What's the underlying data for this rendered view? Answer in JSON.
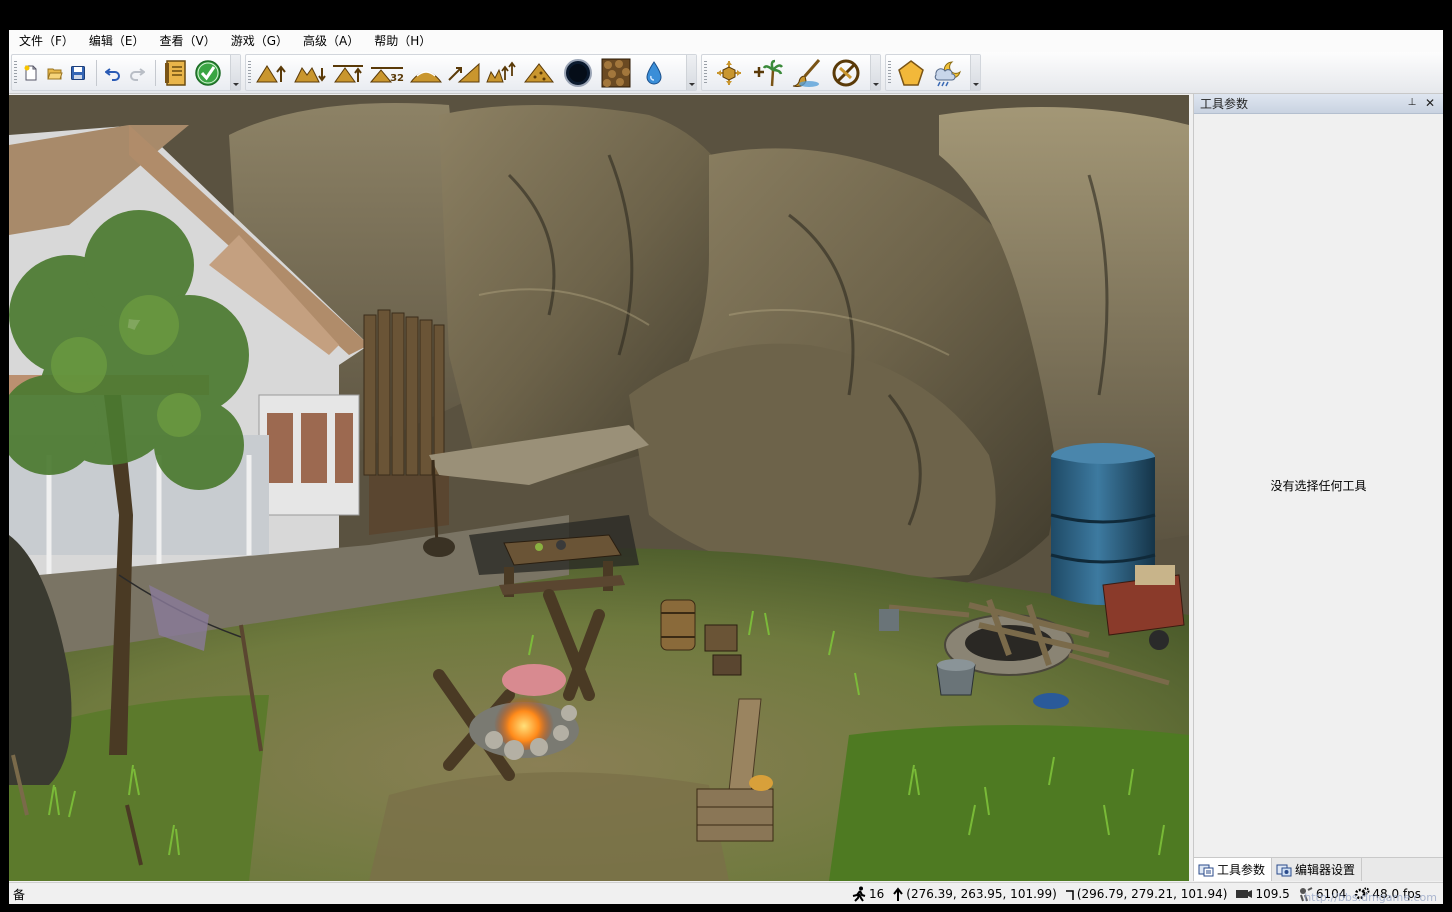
{
  "menu": {
    "file": "文件（F）",
    "edit": "编辑（E）",
    "view": "查看（V）",
    "game": "游戏（G）",
    "advanced": "高级（A）",
    "help": "帮助（H）"
  },
  "toolbar": {
    "icons": [
      "new-file-icon",
      "open-folder-icon",
      "save-icon",
      "undo-icon",
      "redo-icon",
      "properties-icon",
      "validate-icon",
      "raise-terrain-icon",
      "lower-terrain-icon",
      "flatten-terrain-icon",
      "set-height-icon",
      "smooth-terrain-icon",
      "ramp-icon",
      "noise-icon",
      "erode-icon",
      "sky-sphere-icon",
      "texture-paint-icon",
      "water-icon",
      "object-place-icon",
      "vegetation-icon",
      "paint-brush-icon",
      "no-collision-icon",
      "shape-icon",
      "weather-icon"
    ],
    "set_height_value": "32"
  },
  "panel": {
    "title": "工具参数",
    "pin_label": "⊥",
    "close_label": "✕",
    "empty_message": "没有选择任何工具",
    "tabs": [
      {
        "label": "工具参数",
        "icon": "tool-params-icon",
        "active": true
      },
      {
        "label": "编辑器设置",
        "icon": "editor-settings-icon",
        "active": false
      }
    ]
  },
  "status": {
    "left_text": "备",
    "speed": "16",
    "cursor_position": "(276.39, 263.95, 101.99)",
    "camera_position": "(296.79, 279.21, 101.94)",
    "view_distance": "109.5",
    "object_count": "6104",
    "fps": "48.0 fps",
    "watermark": "http://bbs.dmgame.com"
  }
}
